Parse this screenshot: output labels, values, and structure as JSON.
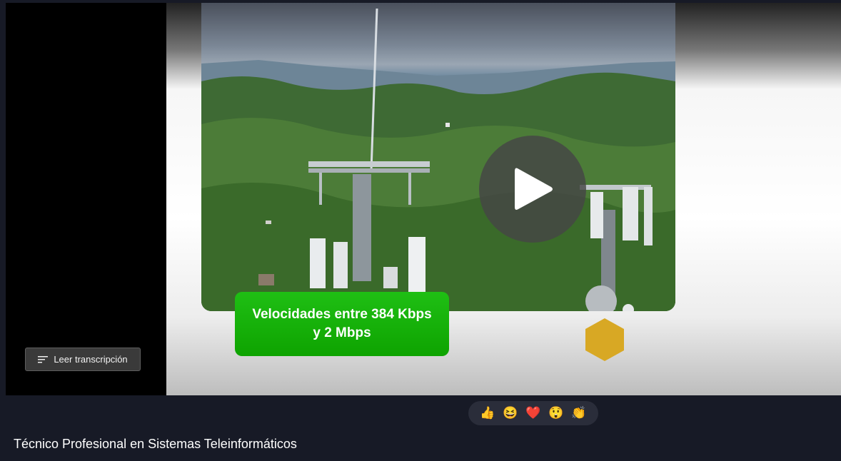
{
  "video": {
    "caption_line1": "Velocidades entre 384 Kbps",
    "caption_line2": "y 2 Mbps",
    "transcript_button_label": "Leer transcripción",
    "play_icon": "play-icon"
  },
  "reactions": [
    {
      "name": "thumbs-up",
      "glyph": "👍"
    },
    {
      "name": "laugh",
      "glyph": "😆"
    },
    {
      "name": "heart",
      "glyph": "❤️"
    },
    {
      "name": "surprised",
      "glyph": "😲"
    },
    {
      "name": "clap",
      "glyph": "👏"
    }
  ],
  "page": {
    "title": "Técnico Profesional en Sistemas Teleinformáticos"
  },
  "colors": {
    "background": "#171a26",
    "caption_green": "#13b30a",
    "hexagon_gold": "#d8a824"
  }
}
